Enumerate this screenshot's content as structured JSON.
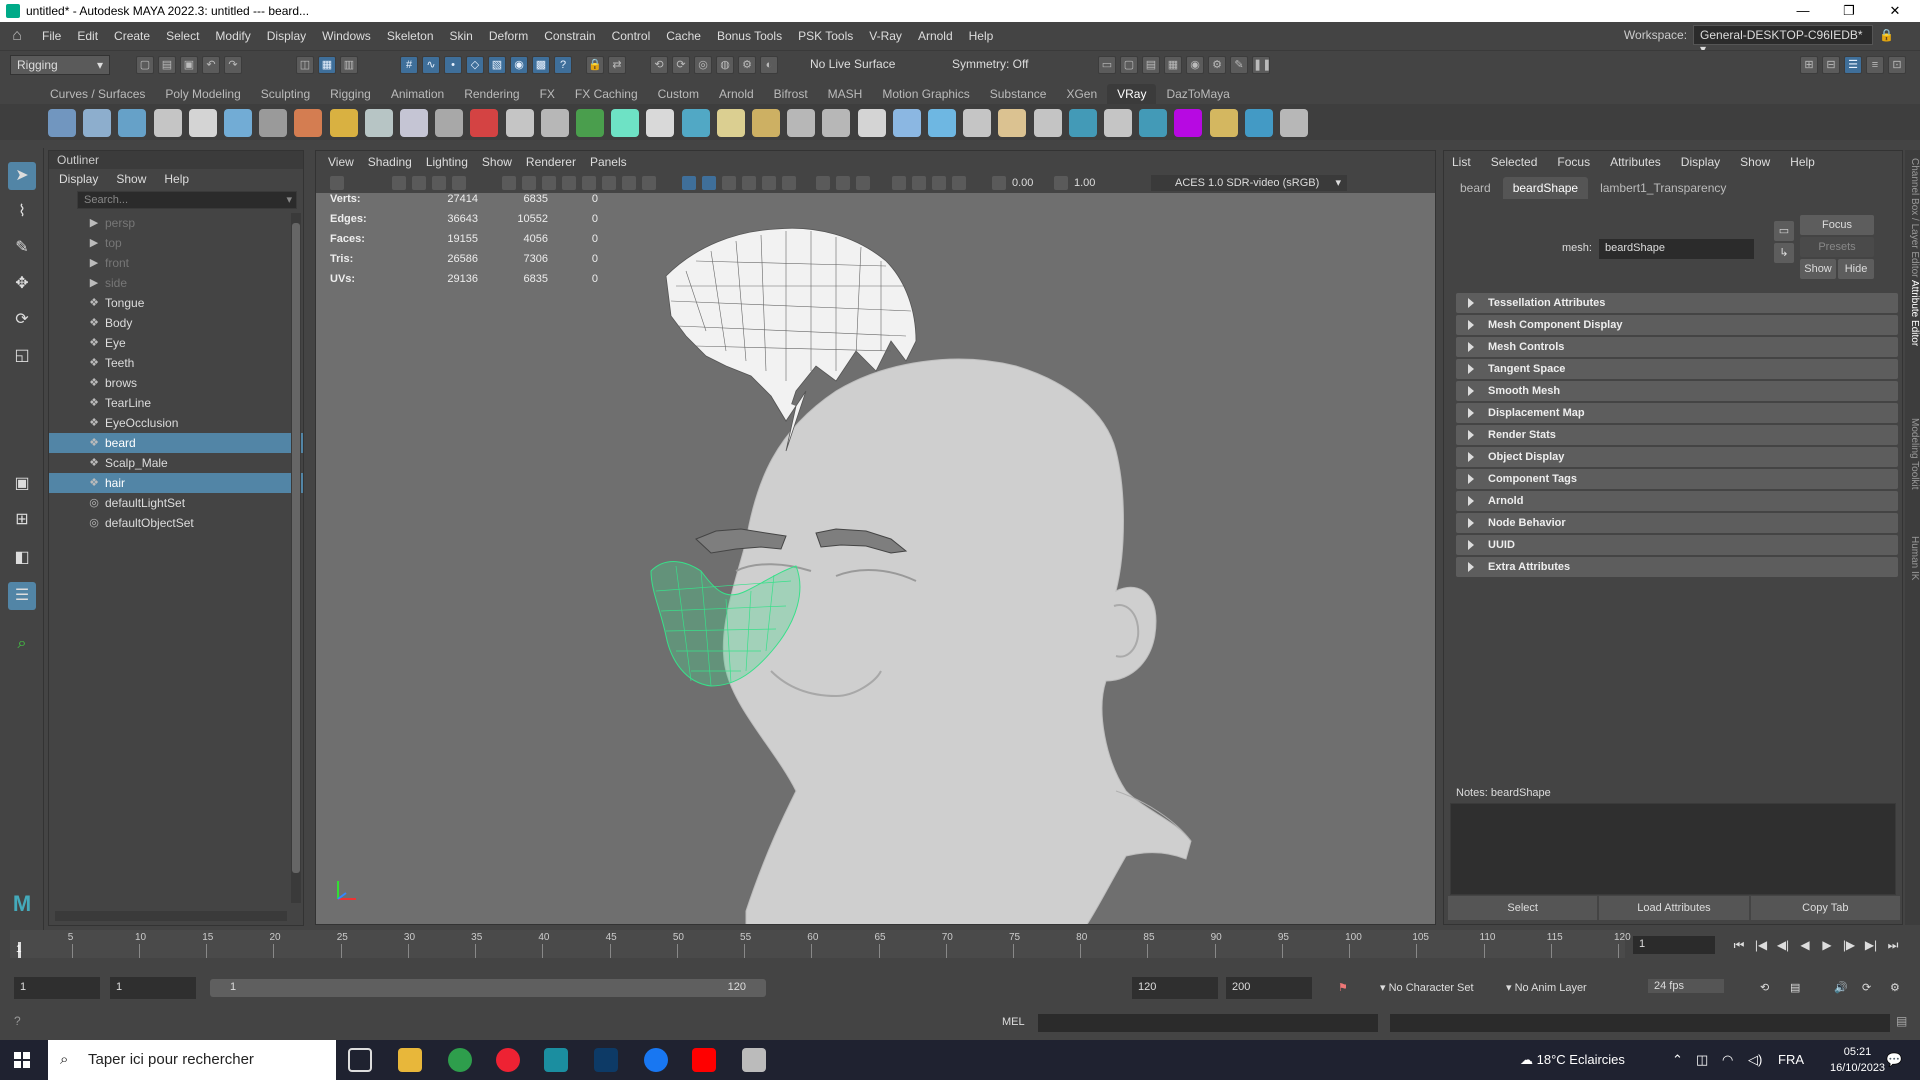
{
  "window": {
    "title": "untitled* - Autodesk MAYA 2022.3: untitled   ---   beard..."
  },
  "menubar": {
    "items": [
      "File",
      "Edit",
      "Create",
      "Select",
      "Modify",
      "Display",
      "Windows",
      "Skeleton",
      "Skin",
      "Deform",
      "Constrain",
      "Control",
      "Cache",
      "Bonus Tools",
      "PSK Tools",
      "V-Ray",
      "Arnold",
      "Help"
    ],
    "workspace_label": "Workspace:",
    "workspace_value": "General-DESKTOP-C96IEDB*"
  },
  "statusline": {
    "mode": "Rigging",
    "live_surface": "No Live Surface",
    "symmetry": "Symmetry: Off"
  },
  "shelf": {
    "tabs": [
      "Curves / Surfaces",
      "Poly Modeling",
      "Sculpting",
      "Rigging",
      "Animation",
      "Rendering",
      "FX",
      "FX Caching",
      "Custom",
      "Arnold",
      "Bifrost",
      "MASH",
      "Motion Graphics",
      "Substance",
      "XGen",
      "VRay",
      "DazToMaya"
    ],
    "active_tab": "VRay"
  },
  "outliner": {
    "title": "Outliner",
    "menu": [
      "Display",
      "Show",
      "Help"
    ],
    "search_placeholder": "Search...",
    "items": [
      {
        "label": "persp",
        "icon": "camera-icon",
        "dim": true
      },
      {
        "label": "top",
        "icon": "camera-icon",
        "dim": true
      },
      {
        "label": "front",
        "icon": "camera-icon",
        "dim": true
      },
      {
        "label": "side",
        "icon": "camera-icon",
        "dim": true
      },
      {
        "label": "Tongue",
        "icon": "transform-icon"
      },
      {
        "label": "Body",
        "icon": "transform-icon"
      },
      {
        "label": "Eye",
        "icon": "transform-icon"
      },
      {
        "label": "Teeth",
        "icon": "transform-icon"
      },
      {
        "label": "brows",
        "icon": "transform-icon"
      },
      {
        "label": "TearLine",
        "icon": "transform-icon"
      },
      {
        "label": "EyeOcclusion",
        "icon": "transform-icon"
      },
      {
        "label": "beard",
        "icon": "transform-icon",
        "selected": true
      },
      {
        "label": "Scalp_Male",
        "icon": "transform-icon"
      },
      {
        "label": "hair",
        "icon": "transform-icon",
        "selected": true
      },
      {
        "label": "defaultLightSet",
        "icon": "set-icon"
      },
      {
        "label": "defaultObjectSet",
        "icon": "set-icon"
      }
    ]
  },
  "viewport": {
    "menu": [
      "View",
      "Shading",
      "Lighting",
      "Show",
      "Renderer",
      "Panels"
    ],
    "exposure": "0.00",
    "gamma": "1.00",
    "color_space": "ACES 1.0 SDR-video (sRGB)",
    "hud": [
      {
        "label": "Verts:",
        "v1": "27414",
        "v2": "6835",
        "v3": "0"
      },
      {
        "label": "Edges:",
        "v1": "36643",
        "v2": "10552",
        "v3": "0"
      },
      {
        "label": "Faces:",
        "v1": "19155",
        "v2": "4056",
        "v3": "0"
      },
      {
        "label": "Tris:",
        "v1": "26586",
        "v2": "7306",
        "v3": "0"
      },
      {
        "label": "UVs:",
        "v1": "29136",
        "v2": "6835",
        "v3": "0"
      }
    ]
  },
  "attribute_editor": {
    "menu": [
      "List",
      "Selected",
      "Focus",
      "Attributes",
      "Display",
      "Show",
      "Help"
    ],
    "tabs": [
      "beard",
      "beardShape",
      "lambert1_Transparency"
    ],
    "active_tab": "beardShape",
    "mesh_label": "mesh:",
    "mesh_value": "beardShape",
    "focus_btn": "Focus",
    "presets_btn": "Presets",
    "show_btn": "Show",
    "hide_btn": "Hide",
    "sections": [
      "Tessellation Attributes",
      "Mesh Component Display",
      "Mesh Controls",
      "Tangent Space",
      "Smooth Mesh",
      "Displacement Map",
      "Render Stats",
      "Object Display",
      "Component Tags",
      "Arnold",
      "Node Behavior",
      "UUID",
      "Extra Attributes"
    ],
    "notes_label": "Notes:  beardShape",
    "bottom_buttons": [
      "Select",
      "Load Attributes",
      "Copy Tab"
    ],
    "side_tabs": [
      "Channel Box / Layer Editor",
      "Attribute Editor",
      "Modeling Toolkit",
      "Human IK"
    ]
  },
  "timeline": {
    "ticks": [
      "1",
      "5",
      "10",
      "15",
      "20",
      "25",
      "30",
      "35",
      "40",
      "45",
      "50",
      "55",
      "60",
      "65",
      "70",
      "75",
      "80",
      "85",
      "90",
      "95",
      "100",
      "105",
      "110",
      "115",
      "120"
    ],
    "current_frame": "1",
    "frame_field": "1"
  },
  "range": {
    "start": "1",
    "anim_start": "1",
    "slider_start": "1",
    "slider_end": "120",
    "end": "120",
    "anim_end": "200",
    "character_set": "No Character Set",
    "anim_layer": "No Anim Layer",
    "fps": "24 fps"
  },
  "cmdline": {
    "label": "MEL"
  },
  "taskbar": {
    "search_placeholder": "Taper ici pour rechercher",
    "weather": "18°C  Eclaircies",
    "language": "FRA",
    "time": "05:21",
    "date": "16/10/2023"
  }
}
